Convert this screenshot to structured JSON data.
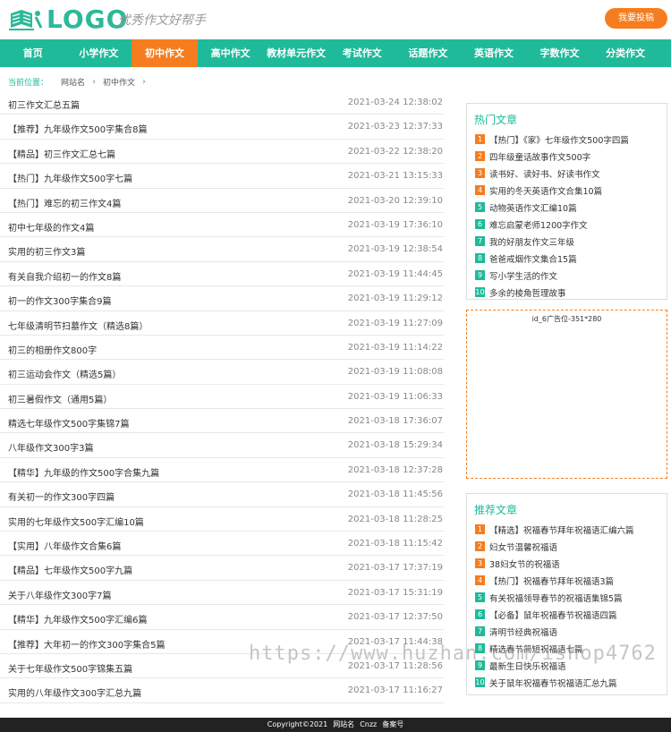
{
  "header": {
    "logo_text": "LOGO",
    "slogan": "优秀作文好帮手",
    "submit_label": "我要投稿"
  },
  "nav": {
    "items": [
      "首页",
      "小学作文",
      "初中作文",
      "高中作文",
      "教材单元作文",
      "考试作文",
      "话题作文",
      "英语作文",
      "字数作文",
      "分类作文"
    ],
    "active_index": 2
  },
  "breadcrumb": {
    "label": "当前位置：",
    "items": [
      "网站名",
      "初中作文"
    ]
  },
  "articles": [
    {
      "title": "初三作文汇总五篇",
      "date": "2021-03-24 12:38:02"
    },
    {
      "title": "【推荐】九年级作文500字集合8篇",
      "date": "2021-03-23 12:37:33"
    },
    {
      "title": "【精品】初三作文汇总七篇",
      "date": "2021-03-22 12:38:20"
    },
    {
      "title": "【热门】九年级作文500字七篇",
      "date": "2021-03-21 13:15:33"
    },
    {
      "title": "【热门】难忘的初三作文4篇",
      "date": "2021-03-20 12:39:10"
    },
    {
      "title": "初中七年级的作文4篇",
      "date": "2021-03-19 17:36:10"
    },
    {
      "title": "实用的初三作文3篇",
      "date": "2021-03-19 12:38:54"
    },
    {
      "title": "有关自我介绍初一的作文8篇",
      "date": "2021-03-19 11:44:45"
    },
    {
      "title": "初一的作文300字集合9篇",
      "date": "2021-03-19 11:29:12"
    },
    {
      "title": "七年级清明节扫墓作文（精选8篇）",
      "date": "2021-03-19 11:27:09"
    },
    {
      "title": "初三的相册作文800字",
      "date": "2021-03-19 11:14:22"
    },
    {
      "title": "初三运动会作文（精选5篇）",
      "date": "2021-03-19 11:08:08"
    },
    {
      "title": "初三暑假作文（通用5篇）",
      "date": "2021-03-19 11:06:33"
    },
    {
      "title": "精选七年级作文500字集锦7篇",
      "date": "2021-03-18 17:36:07"
    },
    {
      "title": "八年级作文300字3篇",
      "date": "2021-03-18 15:29:34"
    },
    {
      "title": "【精华】九年级的作文500字合集九篇",
      "date": "2021-03-18 12:37:28"
    },
    {
      "title": "有关初一的作文300字四篇",
      "date": "2021-03-18 11:45:56"
    },
    {
      "title": "实用的七年级作文500字汇编10篇",
      "date": "2021-03-18 11:28:25"
    },
    {
      "title": "【实用】八年级作文合集6篇",
      "date": "2021-03-18 11:15:42"
    },
    {
      "title": "【精品】七年级作文500字九篇",
      "date": "2021-03-17 17:37:19"
    },
    {
      "title": "关于八年级作文300字7篇",
      "date": "2021-03-17 15:31:19"
    },
    {
      "title": "【精华】九年级作文500字汇编6篇",
      "date": "2021-03-17 12:37:50"
    },
    {
      "title": "【推荐】大年初一的作文300字集合5篇",
      "date": "2021-03-17 11:44:38"
    },
    {
      "title": "关于七年级作文500字锦集五篇",
      "date": "2021-03-17 11:28:56"
    },
    {
      "title": "实用的八年级作文300字汇总九篇",
      "date": "2021-03-17 11:16:27"
    }
  ],
  "hot": {
    "title": "热门文章",
    "items": [
      "【热门】《家》七年级作文500字四篇",
      "四年级童话故事作文500字",
      "读书好、读好书、好读书作文",
      "实用的冬天英语作文合集10篇",
      "动物英语作文汇编10篇",
      "难忘启蒙老师1200字作文",
      "我的好朋友作文三年级",
      "爸爸戒烟作文集合15篇",
      "写小学生活的作文",
      "多余的棱角哲理故事"
    ]
  },
  "ad": {
    "label": "id_6广告位-351*280"
  },
  "recommend": {
    "title": "推荐文章",
    "items": [
      "【精选】祝福春节拜年祝福语汇编六篇",
      "妇女节温馨祝福语",
      "38妇女节的祝福语",
      "【热门】祝福春节拜年祝福语3篇",
      "有关祝福领导春节的祝福语集锦5篇",
      "【必备】鼠年祝福春节祝福语四篇",
      "清明节经典祝福语",
      "精选春节简短祝福语七篇",
      "最新生日快乐祝福语",
      "关于鼠年祝福春节祝福语汇总九篇"
    ]
  },
  "watermark": "https://www.huzhan.com/ishop4762",
  "footer": {
    "items": [
      "Copyright©2021",
      "网站名",
      "Cnzz",
      "备案号"
    ]
  },
  "colors": {
    "accent": "#1fba9a",
    "highlight": "#f57d1f"
  }
}
